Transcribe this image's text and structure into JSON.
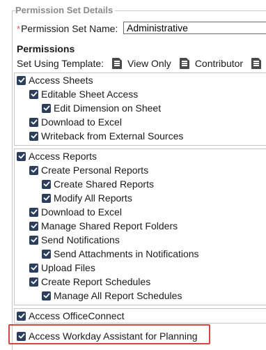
{
  "fieldset": {
    "legend": "Permission Set Details"
  },
  "name_field": {
    "required_marker": "*",
    "label": "Permission Set Name:",
    "value": "Administrative"
  },
  "permissions": {
    "heading": "Permissions",
    "template_label": "Set Using Template:",
    "templates": [
      "View Only",
      "Contributor"
    ]
  },
  "groups": {
    "sheets": [
      {
        "label": "Access Sheets",
        "checked": true
      },
      {
        "label": "Editable Sheet Access",
        "checked": true
      },
      {
        "label": "Edit Dimension on Sheet",
        "checked": true
      },
      {
        "label": "Download to Excel",
        "checked": true
      },
      {
        "label": "Writeback from External Sources",
        "checked": true
      }
    ],
    "reports": [
      {
        "label": "Access Reports",
        "checked": true
      },
      {
        "label": "Create Personal Reports",
        "checked": true
      },
      {
        "label": "Create Shared Reports",
        "checked": true
      },
      {
        "label": "Modify All Reports",
        "checked": true
      },
      {
        "label": "Download to Excel",
        "checked": true
      },
      {
        "label": "Manage Shared Report Folders",
        "checked": true
      },
      {
        "label": "Send Notifications",
        "checked": true
      },
      {
        "label": "Send Attachments in Notifications",
        "checked": true
      },
      {
        "label": "Upload Files",
        "checked": true
      },
      {
        "label": "Create Report Schedules",
        "checked": true
      },
      {
        "label": "Manage All Report Schedules",
        "checked": true
      }
    ],
    "office": [
      {
        "label": "Access OfficeConnect",
        "checked": true
      }
    ],
    "assistant": [
      {
        "label": "Access Workday Assistant for Planning",
        "checked": true
      }
    ]
  },
  "colors": {
    "checkbox": "#2b3f5c",
    "highlight": "#d64541"
  }
}
